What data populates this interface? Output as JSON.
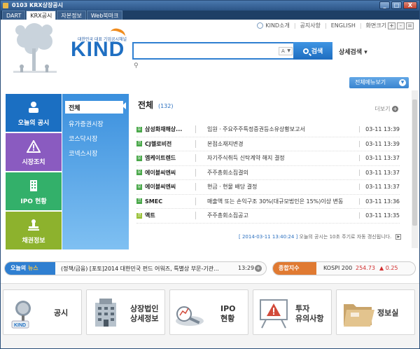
{
  "window": {
    "title": "0103 KRX상장공시",
    "buttons": [
      "_",
      "□",
      "X"
    ]
  },
  "tabs": [
    {
      "label": "DART"
    },
    {
      "label": "KRX공시"
    },
    {
      "label": "자본정보"
    },
    {
      "label": "Web북마크"
    }
  ],
  "topmenu": {
    "about": "KIND소개",
    "notice": "공지사항",
    "english": "ENGLISH",
    "zoom_label": "화면크기",
    "zoom_buttons": [
      "+",
      "-",
      "="
    ]
  },
  "logo": {
    "tagline": "대한민국 대표 기업공시채널",
    "name": "KIND"
  },
  "search": {
    "placeholder": "",
    "dropdown": "A",
    "button": "검색",
    "detail": "상세검색 ▾"
  },
  "fullmenu": "전체메뉴보기",
  "categories": [
    {
      "label": "오늘의 공시",
      "icon": "person-icon"
    },
    {
      "label": "시장조치",
      "icon": "warning-icon"
    },
    {
      "label": "IPO 현황",
      "icon": "building-icon"
    },
    {
      "label": "채권정보",
      "icon": "stamp-icon"
    }
  ],
  "submenu": [
    "전체",
    "유가증권시장",
    "코스닥시장",
    "코넥스시장"
  ],
  "panel": {
    "title": "전체",
    "count": "(132)",
    "more": "더보기",
    "rows": [
      {
        "company": "삼성화재해상...",
        "title": "임원ㆍ주요주주특정증권등소유상황보고서",
        "time": "03-11 13:39"
      },
      {
        "company": "CJ헬로비전",
        "title": "본점소재지변경",
        "time": "03-11 13:39"
      },
      {
        "company": "엠케이트렌드",
        "title": "자기주식취득 신탁계약 해지 결정",
        "time": "03-11 13:37"
      },
      {
        "company": "에이블씨엔씨",
        "title": "주주총회소집결의",
        "time": "03-11 13:37"
      },
      {
        "company": "에이블씨엔씨",
        "title": "현금ㆍ현물 배당 결정",
        "time": "03-11 13:37"
      },
      {
        "company": "SMEC",
        "title": "매출액 또는 손익구조 30%(대규모법인은 15%)이상 변동",
        "time": "03-11 13:36"
      },
      {
        "company": "액트",
        "title": "주주총회소집공고",
        "time": "03-11 13:35"
      }
    ],
    "refresh_time": "[ 2014-03-11 13:40:24 ]",
    "refresh_note": "오늘의 공시는 10초 주기로 자동 갱신됩니다."
  },
  "news": {
    "label_a": "오늘의",
    "label_b": "뉴스",
    "text": "(정책/금융) [포토]2014 대한민국 펀드 어워즈, 특별상 부문-기관...",
    "time": "13:29",
    "plus": "+"
  },
  "index": {
    "label": "종합지수",
    "name": "KOSPI 200",
    "value": "254.73",
    "change": "▲ 0.25"
  },
  "quick": [
    {
      "label": "공시",
      "icon": "microphone-icon"
    },
    {
      "label": "상장법인\n상세정보",
      "icon": "building-icon"
    },
    {
      "label": "IPO\n현황",
      "icon": "chart-icon"
    },
    {
      "label": "투자\n유의사항",
      "icon": "warning-board-icon"
    },
    {
      "label": "정보실",
      "icon": "folder-icon"
    }
  ]
}
